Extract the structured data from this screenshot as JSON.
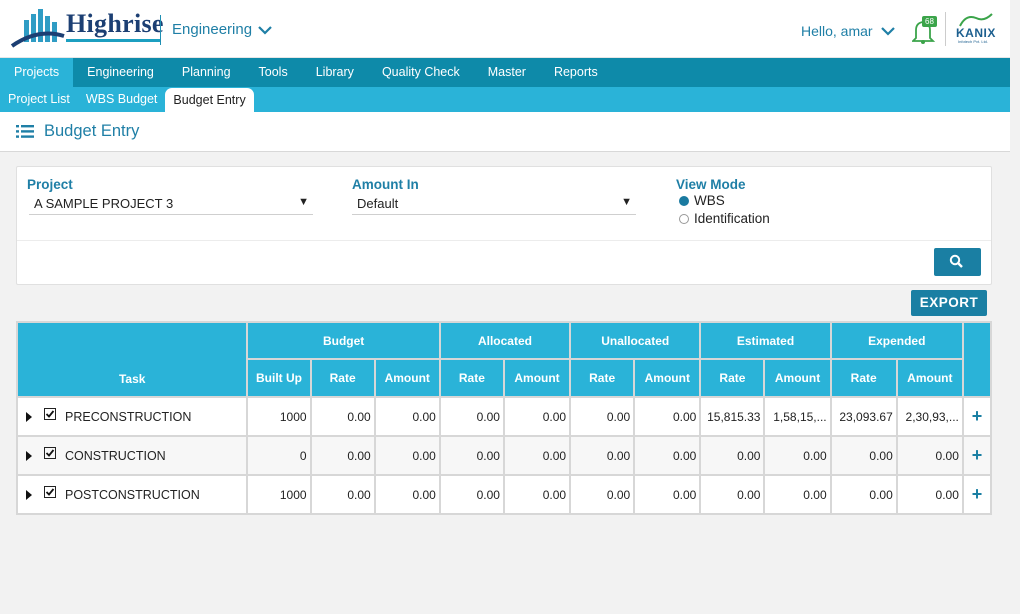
{
  "header": {
    "logo_text": "Highrise",
    "module": "Engineering",
    "greeting": "Hello, amar",
    "notification_count": "68",
    "brand_logo_text": "KANIX",
    "brand_logo_sub": "Infotech Pvt. Ltd."
  },
  "mainnav": [
    "Projects",
    "Engineering",
    "Planning",
    "Tools",
    "Library",
    "Quality Check",
    "Master",
    "Reports"
  ],
  "subnav": [
    "Project List",
    "WBS Budget",
    "Budget Entry"
  ],
  "page_title": "Budget Entry",
  "filters": {
    "project_label": "Project",
    "project_value": "A SAMPLE PROJECT 3",
    "amount_label": "Amount In",
    "amount_value": "Default",
    "viewmode_label": "View Mode",
    "viewmode_options": [
      "WBS",
      "Identification"
    ],
    "viewmode_selected": "WBS"
  },
  "export_label": "EXPORT",
  "table": {
    "task_header": "Task",
    "groups": [
      "Budget",
      "Allocated",
      "Unallocated",
      "Estimated",
      "Expended"
    ],
    "subheaders": [
      "Built Up",
      "Rate",
      "Amount",
      "Rate",
      "Amount",
      "Rate",
      "Amount",
      "Rate",
      "Amount",
      "Rate",
      "Amount"
    ],
    "rows": [
      {
        "task": "PRECONSTRUCTION",
        "values": [
          "1000",
          "0.00",
          "0.00",
          "0.00",
          "0.00",
          "0.00",
          "0.00",
          "15,815.33",
          "1,58,15,...",
          "23,093.67",
          "2,30,93,..."
        ]
      },
      {
        "task": "CONSTRUCTION",
        "values": [
          "0",
          "0.00",
          "0.00",
          "0.00",
          "0.00",
          "0.00",
          "0.00",
          "0.00",
          "0.00",
          "0.00",
          "0.00"
        ]
      },
      {
        "task": "POSTCONSTRUCTION",
        "values": [
          "1000",
          "0.00",
          "0.00",
          "0.00",
          "0.00",
          "0.00",
          "0.00",
          "0.00",
          "0.00",
          "0.00",
          "0.00"
        ]
      }
    ],
    "add_symbol": "+"
  },
  "colors": {
    "nav_dark": "#0e8aa9",
    "nav_light": "#2ab3d8",
    "accent": "#1f7fa6",
    "button": "#1a7fa3"
  }
}
